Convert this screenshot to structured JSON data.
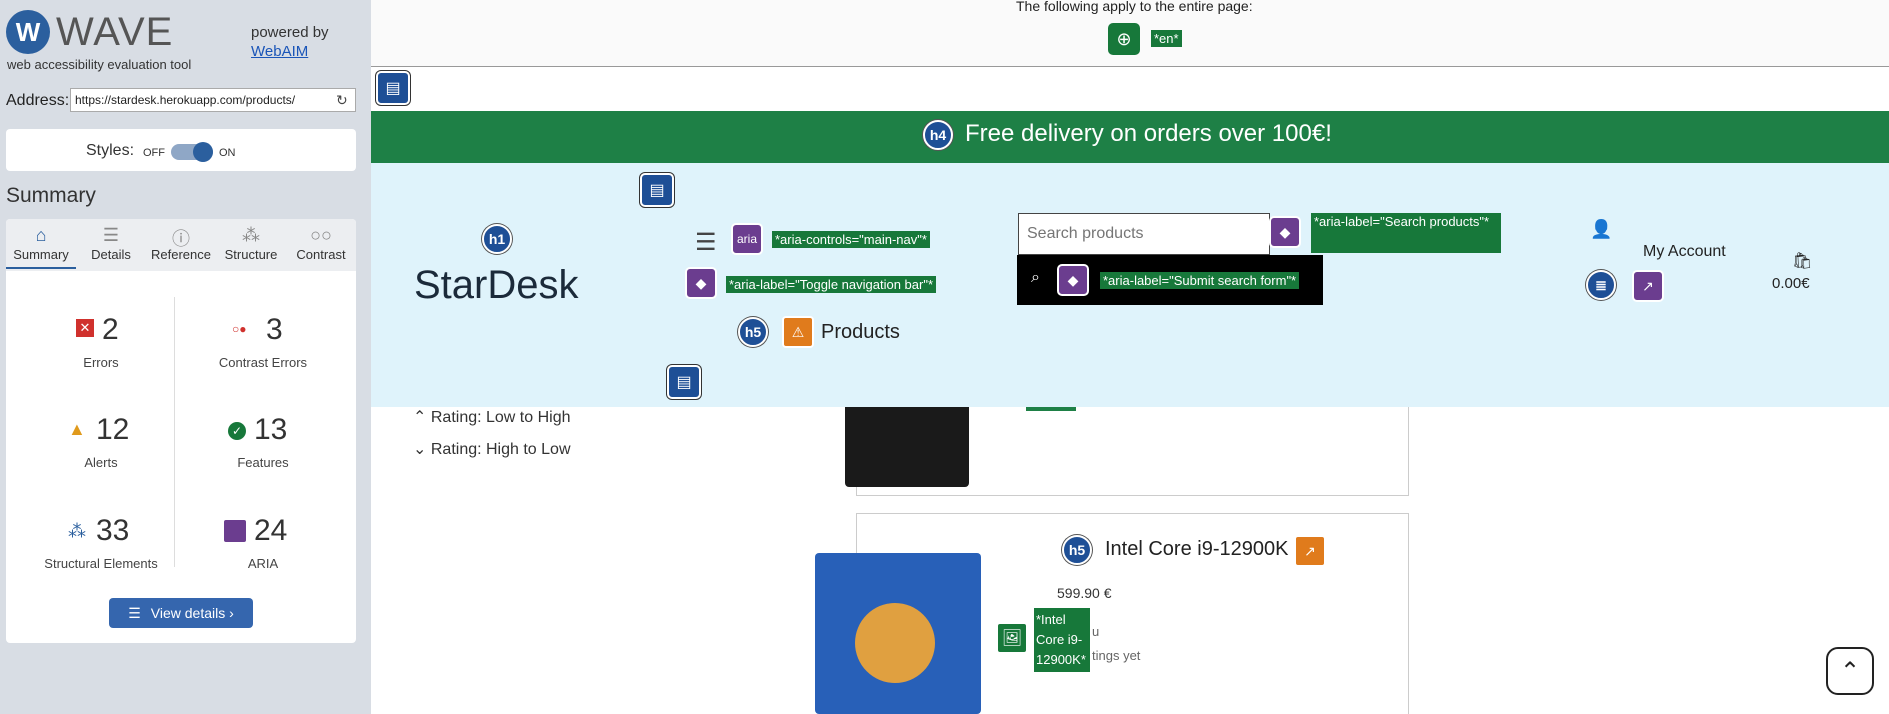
{
  "wave": {
    "title": "WAVE",
    "tagline": "web accessibility evaluation tool",
    "powered_by": "powered by",
    "webaim": "WebAIM",
    "address_label": "Address:",
    "address_value": "https://stardesk.herokuapp.com/products/",
    "styles_label": "Styles:",
    "styles_off": "OFF",
    "styles_on": "ON",
    "summary_heading": "Summary",
    "tabs": [
      {
        "label": "Summary",
        "icon": "home-icon"
      },
      {
        "label": "Details",
        "icon": "list-icon"
      },
      {
        "label": "Reference",
        "icon": "info-icon"
      },
      {
        "label": "Structure",
        "icon": "structure-icon"
      },
      {
        "label": "Contrast",
        "icon": "contrast-icon"
      }
    ],
    "stats": {
      "errors": {
        "num": "2",
        "label": "Errors"
      },
      "contrast": {
        "num": "3",
        "label": "Contrast Errors"
      },
      "alerts": {
        "num": "12",
        "label": "Alerts"
      },
      "features": {
        "num": "13",
        "label": "Features"
      },
      "structural": {
        "num": "33",
        "label": "Structural Elements"
      },
      "aria": {
        "num": "24",
        "label": "ARIA"
      }
    },
    "view_details": "View details ›",
    "colors": {
      "accent": "#2b5f9e",
      "error": "#d0312d",
      "feature": "#17783a",
      "aria": "#6b3d8f"
    }
  },
  "page": {
    "top_note": "The following apply to the entire page:",
    "lang": "*en*",
    "banner": "Free delivery on orders over 100€!",
    "brand": "StarDesk",
    "aria_controls": "*aria-controls=\"main-nav\"*",
    "aria_toggle": "*aria-label=\"Toggle navigation bar\"*",
    "aria_search": "*aria-label=\"Search products\"*",
    "aria_submit": "*aria-label=\"Submit search form\"*",
    "search_placeholder": "Search products",
    "products": "Products",
    "my_account": "My Account",
    "cart": "0.00€",
    "sort_low": "Rating: Low to High",
    "sort_high": "Rating: High to Low",
    "product_name": "Intel Core i9-12900K",
    "product_price": "599.90 €",
    "product_alt": "*Intel Core i9-12900K*",
    "product_frag1": "u",
    "product_frag2": "tings yet",
    "icons": {
      "h1": "h1",
      "h4": "h4",
      "h5": "h5",
      "aria": "aria"
    }
  }
}
